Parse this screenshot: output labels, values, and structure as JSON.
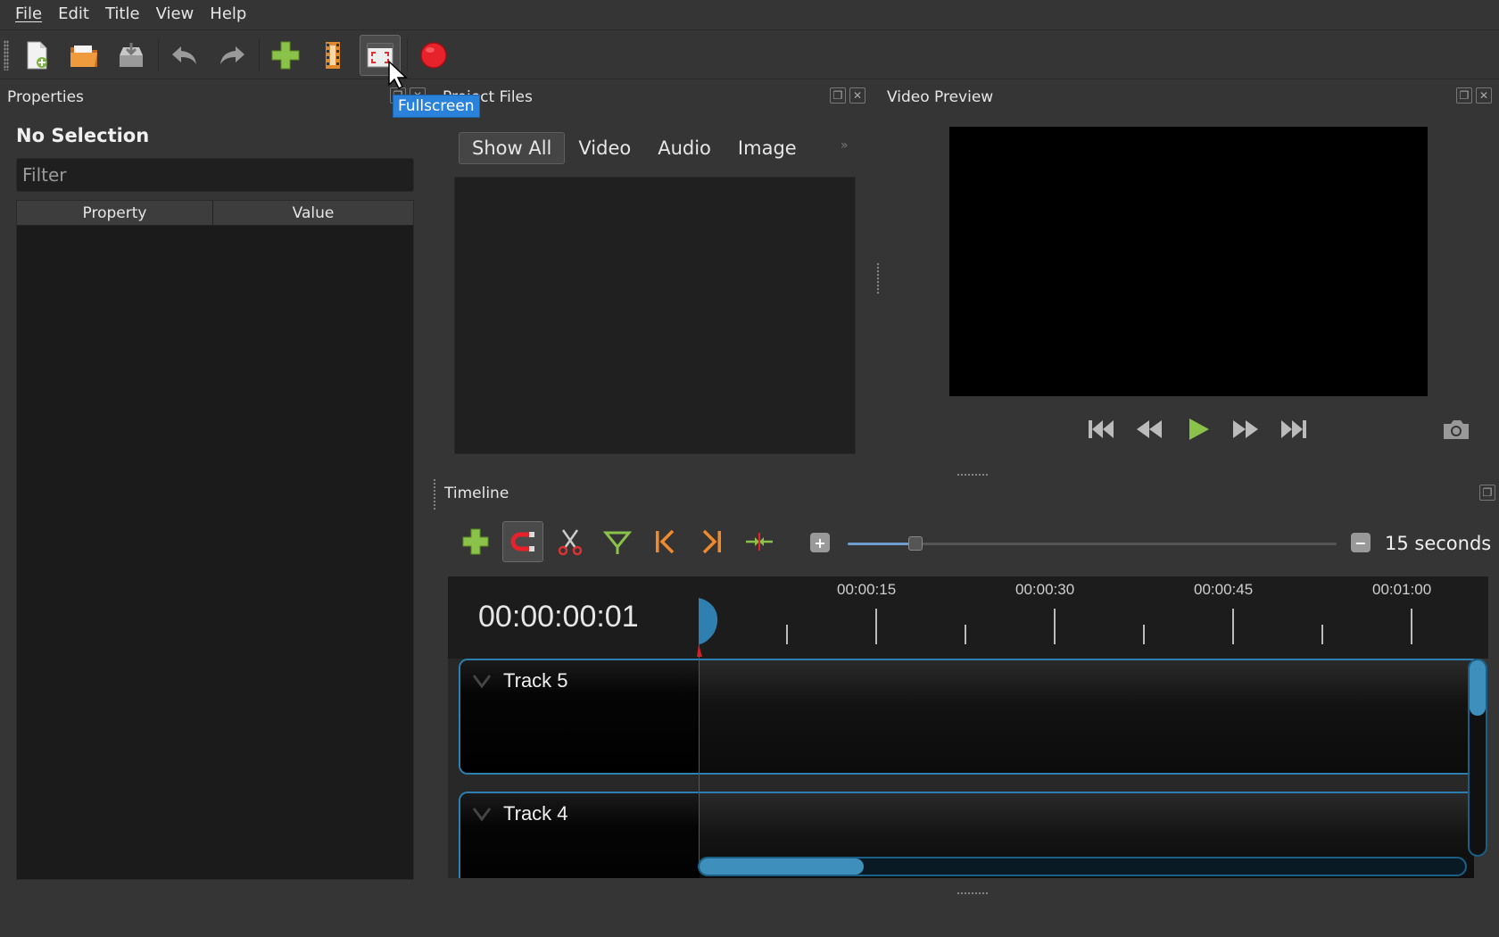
{
  "menu": [
    "File",
    "Edit",
    "Title",
    "View",
    "Help"
  ],
  "toolbar": {
    "tooltip": "Fullscreen",
    "icons": [
      "new-project-icon",
      "open-project-icon",
      "save-project-icon",
      "undo-icon",
      "redo-icon",
      "import-files-icon",
      "choose-profile-icon",
      "fullscreen-icon",
      "export-video-icon"
    ]
  },
  "properties": {
    "title": "Properties",
    "selection": "No Selection",
    "filter_placeholder": "Filter",
    "columns": [
      "Property",
      "Value"
    ]
  },
  "project_files": {
    "title": "Project Files",
    "tabs": [
      "Show All",
      "Video",
      "Audio",
      "Image"
    ],
    "active_tab": "Show All",
    "more": "»"
  },
  "video_preview": {
    "title": "Video Preview"
  },
  "timeline": {
    "title": "Timeline",
    "zoom_label": "15 seconds",
    "zoom_out": "−",
    "zoom_in": "−",
    "timecode": "00:00:00:01",
    "ticks": [
      "00:00:15",
      "00:00:30",
      "00:00:45",
      "00:01:00"
    ],
    "tracks": [
      "Track 5",
      "Track 4"
    ]
  },
  "colors": {
    "accent": "#2a82da",
    "track_border": "#2c7fb0",
    "playhead": "#d0222b",
    "record": "#e8222a",
    "green": "#8bc34a"
  }
}
